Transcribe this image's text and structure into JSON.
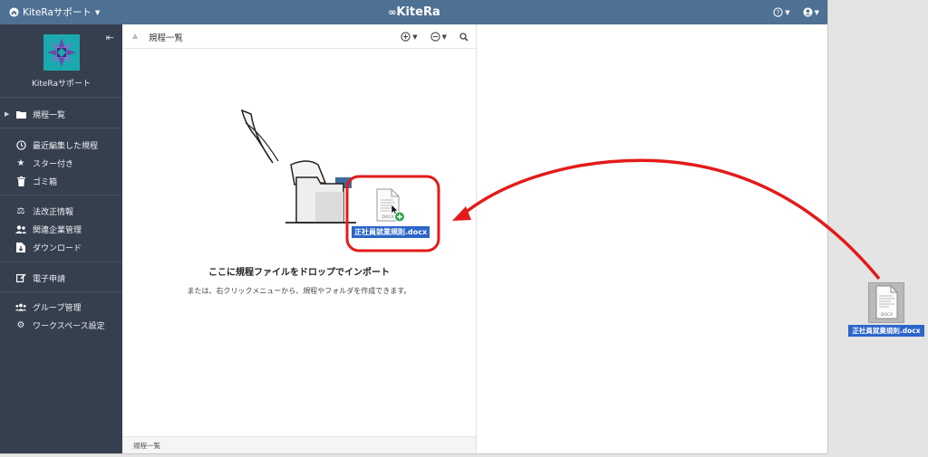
{
  "topbar": {
    "workspace": "KiteRaサポート",
    "brand": "KiteRa",
    "help_icon": "question-circle-icon",
    "user_icon": "user-circle-icon"
  },
  "sidebar": {
    "workspace_name": "KiteRaサポート",
    "items": [
      {
        "label": "規程一覧",
        "icon": "folder-icon"
      },
      {
        "label": "最近編集した規程",
        "icon": "clock-icon"
      },
      {
        "label": "スター付き",
        "icon": "star-icon"
      },
      {
        "label": "ゴミ箱",
        "icon": "trash-icon"
      },
      {
        "label": "法改正情報",
        "icon": "scale-icon"
      },
      {
        "label": "関連企業管理",
        "icon": "users-icon"
      },
      {
        "label": "ダウンロード",
        "icon": "download-icon"
      },
      {
        "label": "電子申請",
        "icon": "edit-icon"
      },
      {
        "label": "グループ管理",
        "icon": "group-icon"
      },
      {
        "label": "ワークスペース設定",
        "icon": "gear-icon"
      }
    ]
  },
  "panel": {
    "title": "規程一覧",
    "footer": "規程一覧"
  },
  "dropzone": {
    "title": "ここに規程ファイルをドロップでインポート",
    "subtitle": "または、右クリックメニューから、規程やフォルダを作成できます。"
  },
  "dragged_file": {
    "name": "正社員就業規則.docx",
    "ext": "DOCX"
  },
  "desktop_file": {
    "name": "正社員就業規則.docx",
    "ext": "DOCX"
  },
  "colors": {
    "topbar": "#4e7092",
    "sidebar": "#353f4e",
    "annotation": "#e41a1a",
    "selection": "#2a65c8"
  }
}
